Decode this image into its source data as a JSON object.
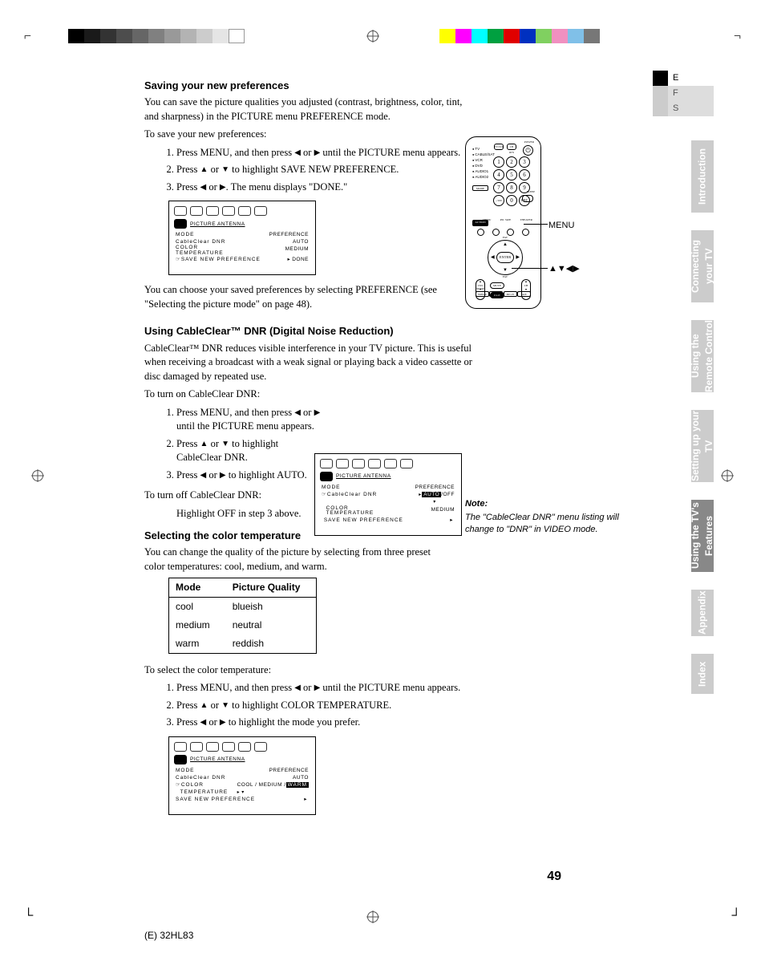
{
  "lang_tabs": [
    "E",
    "F",
    "S"
  ],
  "side_tabs": [
    "Introduction",
    "Connecting your TV",
    "Using the Remote Control",
    "Setting up your TV",
    "Using the TV's Features",
    "Appendix",
    "Index"
  ],
  "h1": "Saving your new preferences",
  "p1": "You can save the picture qualities you adjusted (contrast, brightness, color, tint, and sharpness) in the PICTURE menu PREFERENCE mode.",
  "p1b": "To save your new preferences:",
  "steps1": {
    "a_pre": "Press MENU, and then press ",
    "a_mid": " or ",
    "a_post": " until the PICTURE menu appears.",
    "b_pre": "Press ",
    "b_mid": " or ",
    "b_post": " to highlight SAVE NEW PREFERENCE.",
    "c_pre": "Press ",
    "c_mid": " or ",
    "c_post": ". The menu displays \"DONE.\""
  },
  "osd_common": {
    "tabs": "PICTURE   ANTENNA",
    "row1l": "MODE",
    "row1r": "PREFERENCE",
    "row2l": "CableClear  DNR",
    "row2r_auto": "AUTO",
    "row3l": "COLOR\nTEMPERATURE",
    "row3r_med": "MEDIUM",
    "row4l": "SAVE  NEW   PREFERENCE",
    "done": "DONE",
    "auto_off": "AUTO /OFF",
    "cool_med_warm": "COOL / MEDIUM / WARM",
    "warm_sel": "WARM"
  },
  "p2": "You can choose your saved preferences by selecting PREFERENCE (see \"Selecting the picture mode\" on page 48).",
  "h2": "Using CableClear™ DNR (Digital Noise Reduction)",
  "p3": "CableClear™ DNR reduces visible interference in your TV picture. This is useful when receiving a broadcast with a weak signal or playing back a video cassette or disc damaged by repeated use.",
  "p3b": "To turn on CableClear DNR:",
  "steps2": {
    "a_pre": "Press MENU, and then press ",
    "a_mid": " or ",
    "a_post": " until the PICTURE menu appears.",
    "b_pre": "Press ",
    "b_mid": " or ",
    "b_post": " to highlight CableClear DNR.",
    "c_pre": "Press ",
    "c_mid": " or ",
    "c_post": " to highlight AUTO."
  },
  "p4": "To turn off CableClear DNR:",
  "p4b": "Highlight OFF in step 3 above.",
  "h3": "Selecting the color temperature",
  "p5": "You can change the quality of the picture by selecting from three preset color temperatures: cool, medium, and warm.",
  "table": {
    "head": [
      "Mode",
      "Picture Quality"
    ],
    "rows": [
      [
        "cool",
        "blueish"
      ],
      [
        "medium",
        "neutral"
      ],
      [
        "warm",
        "reddish"
      ]
    ]
  },
  "p6": "To select the color temperature:",
  "steps3": {
    "a_pre": "Press MENU, and then press ",
    "a_mid": " or ",
    "a_post": " until the PICTURE menu appears.",
    "b_pre": "Press ",
    "b_mid": " or ",
    "b_post": " to highlight COLOR TEMPERATURE.",
    "c_pre": "Press ",
    "c_mid": " or ",
    "c_post": " to highlight the mode you prefer."
  },
  "menu_callout": "MENU",
  "arrows_callout": "▲▼◀▶",
  "note_title": "Note:",
  "note_body": "The \"CableClear DNR\" menu listing will change to \"DNR\" in VIDEO mode.",
  "remote": {
    "side": [
      "TV",
      "CABLE/SAT",
      "VCR",
      "DVD",
      "AUDIO1",
      "AUDIO2"
    ],
    "mode": "MODE",
    "power": "POWER",
    "tvvcr": "TV/VCR",
    "chirn": "CH RTN",
    "ent": "ENT",
    "sleep": "SLEEP",
    "action": "ACTION",
    "enter": "ENTER",
    "fav": "FAV",
    "mute": "MUTE",
    "exit": "EXIT",
    "vol": "VOL",
    "ch": "CH",
    "pip_btns": [
      "FREEZE",
      "SOURCE",
      "PIP CH",
      "SIZE"
    ],
    "pip_lbls": [
      "PIP/POP",
      "",
      "",
      ""
    ]
  },
  "page_number": "49",
  "footer": "(E) 32HL83"
}
